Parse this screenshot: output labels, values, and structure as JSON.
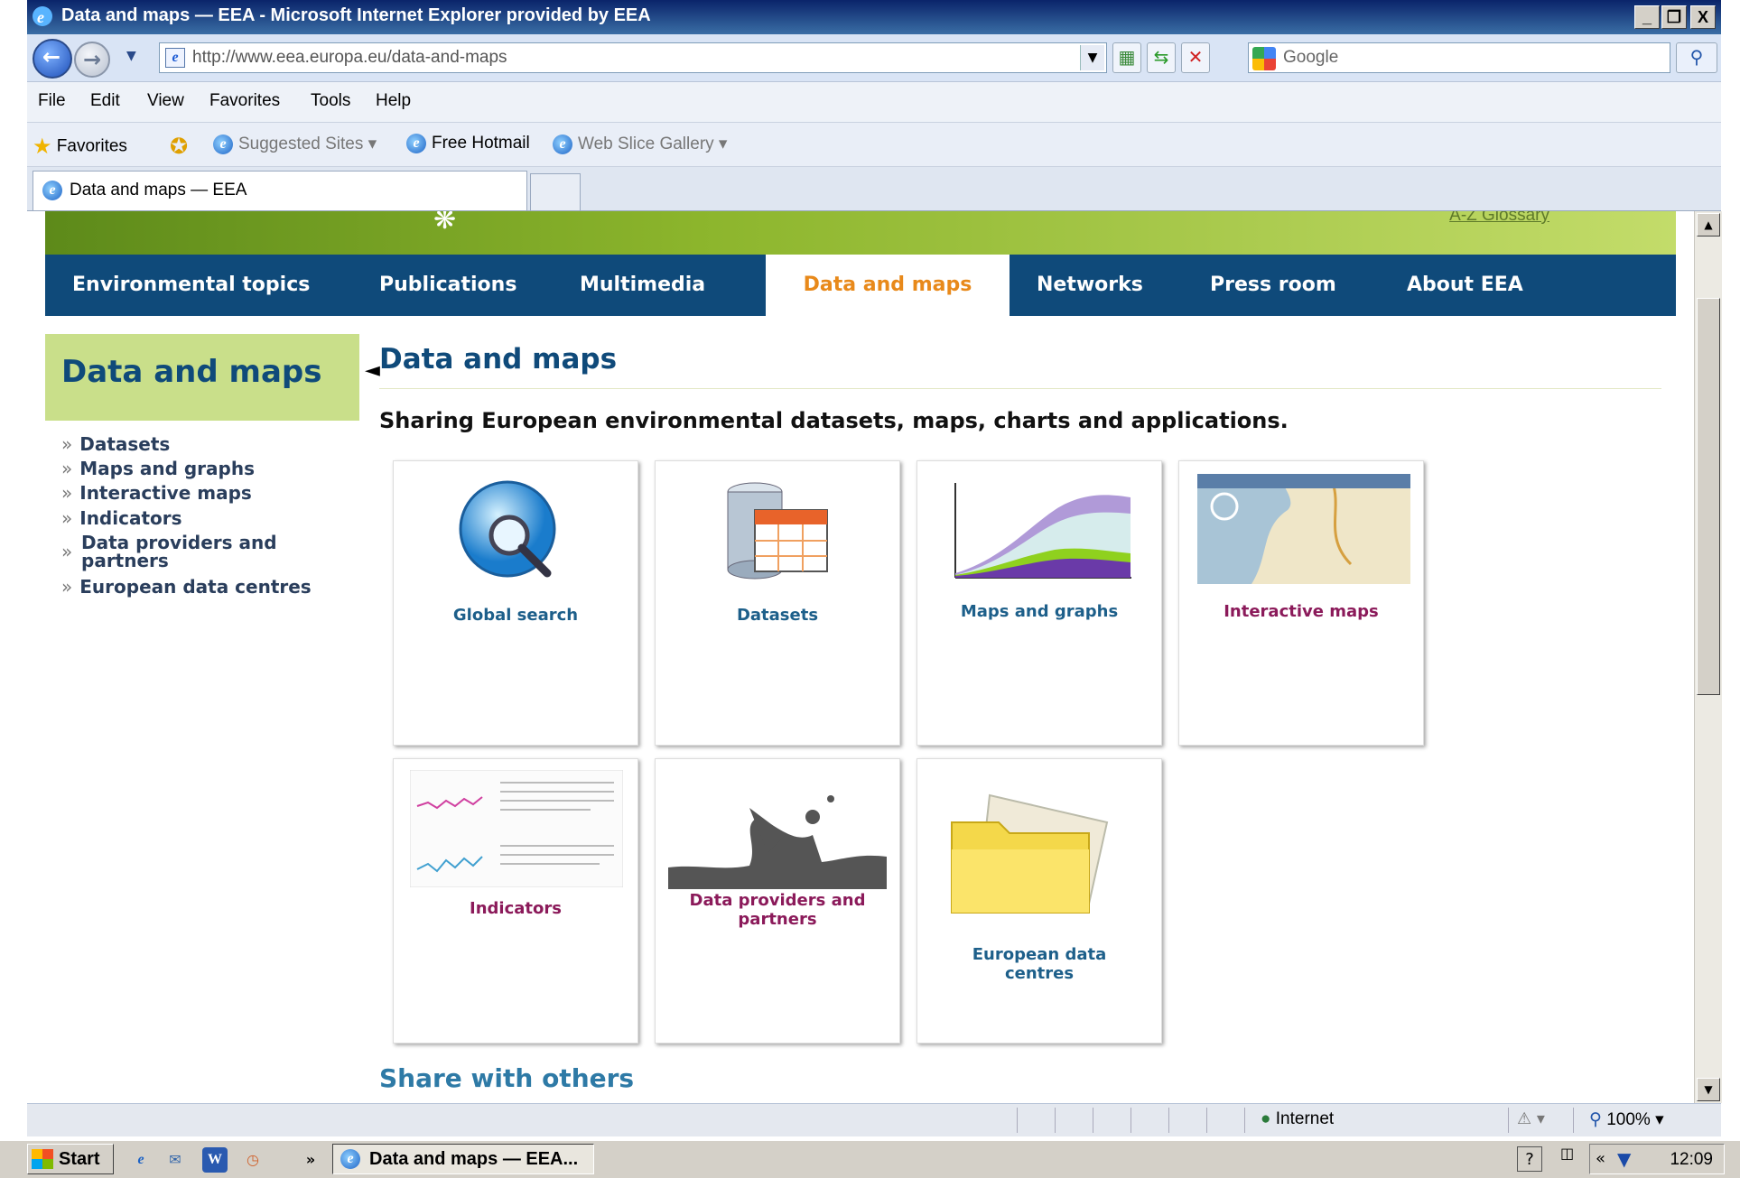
{
  "window": {
    "title": "Data and maps — EEA - Microsoft Internet Explorer provided by EEA",
    "minimize": "_",
    "maximize": "❐",
    "close": "X"
  },
  "toolbar": {
    "address": "http://www.eea.europa.eu/data-and-maps",
    "search_placeholder": "Google"
  },
  "menu": [
    "File",
    "Edit",
    "View",
    "Favorites",
    "Tools",
    "Help"
  ],
  "favorites_bar": {
    "favorites": "Favorites",
    "suggested_sites": "Suggested Sites ▾",
    "free_hotmail": "Free Hotmail",
    "web_slice_gallery": "Web Slice Gallery ▾"
  },
  "tab": {
    "label": "Data and maps — EEA"
  },
  "page": {
    "glossary": "A-Z Glossary",
    "nav": [
      "Environmental topics",
      "Publications",
      "Multimedia",
      "Data and maps",
      "Networks",
      "Press room",
      "About EEA"
    ],
    "sidebar": {
      "heading": "Data and maps",
      "links": [
        "Datasets",
        "Maps and graphs",
        "Interactive maps",
        "Indicators",
        "Data providers and\npartners",
        "European data centres"
      ]
    },
    "title": "Data and maps",
    "subtitle": "Sharing European environmental datasets, maps, charts and applications.",
    "cards": [
      "Global search",
      "Datasets",
      "Maps and graphs",
      "Interactive maps",
      "Indicators",
      "Data providers and\npartners",
      "European data\ncentres"
    ],
    "share_title": "Share with others"
  },
  "status": {
    "zone": "Internet",
    "zoom": "100%"
  },
  "taskbar": {
    "start": "Start",
    "window": "Data and maps — EEA...",
    "clock": "12:09"
  }
}
